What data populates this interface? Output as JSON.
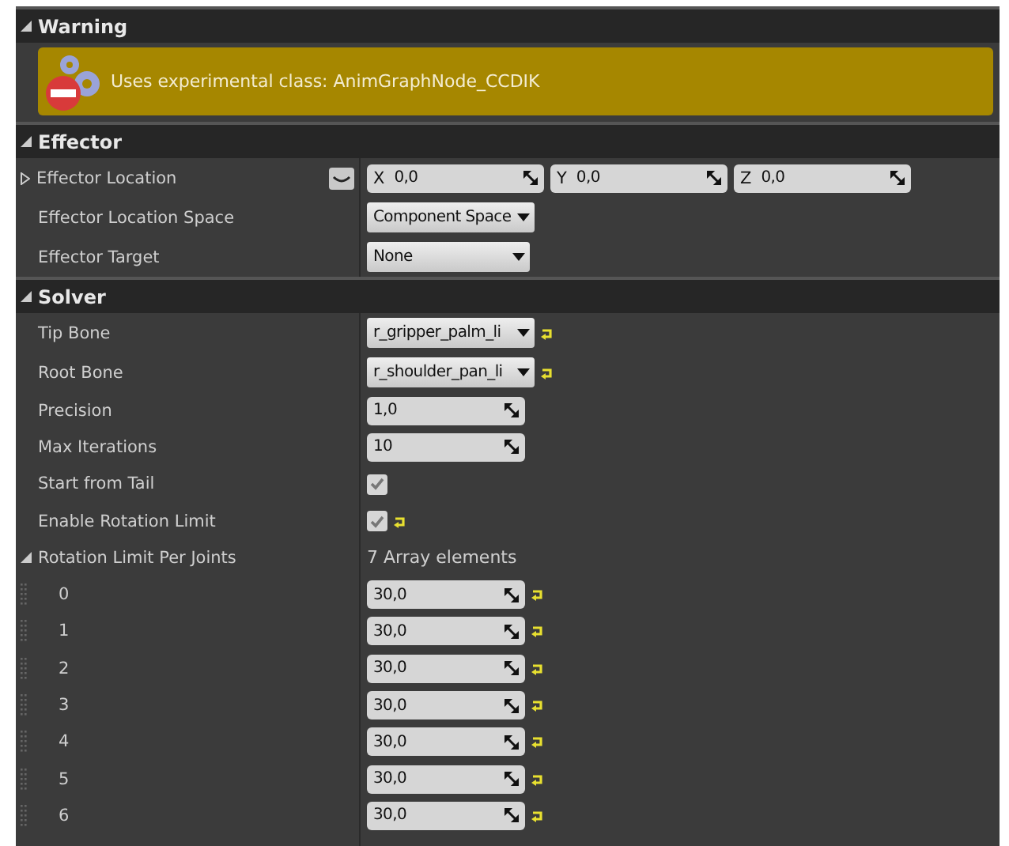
{
  "warning": {
    "title": "Warning",
    "expanded": true,
    "message": "Uses experimental class: AnimGraphNode_CCDIK"
  },
  "sections": [
    {
      "title": "Effector",
      "expanded": true,
      "rows": [
        {
          "kind": "vector",
          "label": "Effector Location",
          "expanded": false,
          "axes": [
            {
              "axis": "X",
              "value": "0,0"
            },
            {
              "axis": "Y",
              "value": "0,0"
            },
            {
              "axis": "Z",
              "value": "0,0"
            }
          ]
        },
        {
          "kind": "dropdown",
          "label": "Effector Location Space",
          "value": "Component Space",
          "reset": false
        },
        {
          "kind": "dropdown",
          "label": "Effector Target",
          "value": "None",
          "reset": false
        }
      ]
    },
    {
      "title": "Solver",
      "expanded": true,
      "rows": [
        {
          "kind": "dropdown",
          "label": "Tip Bone",
          "value": "r_gripper_palm_li",
          "reset": true
        },
        {
          "kind": "dropdown",
          "label": "Root Bone",
          "value": "r_shoulder_pan_li",
          "reset": true
        },
        {
          "kind": "number",
          "label": "Precision",
          "value": "1,0",
          "reset": false
        },
        {
          "kind": "number",
          "label": "Max Iterations",
          "value": "10",
          "reset": false
        },
        {
          "kind": "checkbox",
          "label": "Start from Tail",
          "checked": true,
          "reset": false
        },
        {
          "kind": "checkbox",
          "label": "Enable Rotation Limit",
          "checked": true,
          "reset": true
        },
        {
          "kind": "array",
          "label": "Rotation Limit Per Joints",
          "expanded": true,
          "summary": "7 Array elements",
          "items": [
            {
              "index": "0",
              "value": "30,0",
              "reset": true
            },
            {
              "index": "1",
              "value": "30,0",
              "reset": true
            },
            {
              "index": "2",
              "value": "30,0",
              "reset": true
            },
            {
              "index": "3",
              "value": "30,0",
              "reset": true
            },
            {
              "index": "4",
              "value": "30,0",
              "reset": true
            },
            {
              "index": "5",
              "value": "30,0",
              "reset": true
            },
            {
              "index": "6",
              "value": "30,0",
              "reset": true
            }
          ]
        }
      ]
    }
  ]
}
